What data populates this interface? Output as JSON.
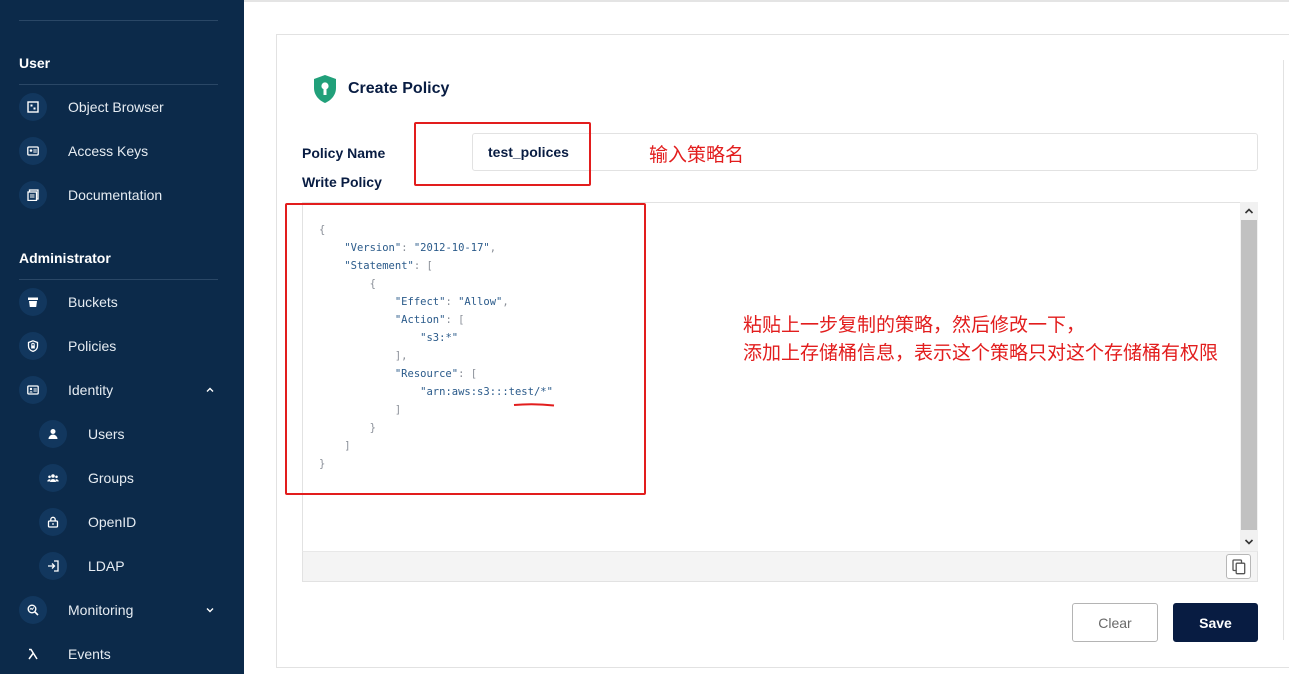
{
  "sidebar": {
    "sections": [
      {
        "title": "User"
      },
      {
        "title": "Administrator"
      }
    ],
    "items": [
      {
        "label": "Object Browser",
        "icon": "object-browser-icon"
      },
      {
        "label": "Access Keys",
        "icon": "access-keys-icon"
      },
      {
        "label": "Documentation",
        "icon": "documentation-icon"
      },
      {
        "label": "Buckets",
        "icon": "buckets-icon"
      },
      {
        "label": "Policies",
        "icon": "policies-icon"
      },
      {
        "label": "Identity",
        "icon": "identity-icon",
        "expanded": true
      },
      {
        "label": "Users",
        "icon": "user-icon"
      },
      {
        "label": "Groups",
        "icon": "groups-icon"
      },
      {
        "label": "OpenID",
        "icon": "openid-icon"
      },
      {
        "label": "LDAP",
        "icon": "ldap-icon"
      },
      {
        "label": "Monitoring",
        "icon": "monitoring-icon",
        "expanded": false
      },
      {
        "label": "Events",
        "icon": "lambda-icon"
      }
    ]
  },
  "form": {
    "title": "Create Policy",
    "policy_name_label": "Policy Name",
    "policy_name_value": "test_polices",
    "write_policy_label": "Write Policy",
    "policy_lines": [
      "{",
      "    \"Version\": \"2012-10-17\",",
      "    \"Statement\": [",
      "        {",
      "            \"Effect\": \"Allow\",",
      "            \"Action\": [",
      "                \"s3:*\"",
      "            ],",
      "            \"Resource\": [",
      "                \"arn:aws:s3:::test/*\"",
      "            ]",
      "        }",
      "    ]",
      "}"
    ],
    "clear_label": "Clear",
    "save_label": "Save"
  },
  "annotations": {
    "name_hint": "输入策略名",
    "policy_hint_line1": "粘贴上一步复制的策略，然后修改一下，",
    "policy_hint_line2": "添加上存储桶信息，表示这个策略只对这个存储桶有权限",
    "color": "#e21d1d"
  },
  "colors": {
    "sidebar_bg": "#0c2a4a",
    "primary": "#081c42",
    "shield": "#21a07a"
  }
}
